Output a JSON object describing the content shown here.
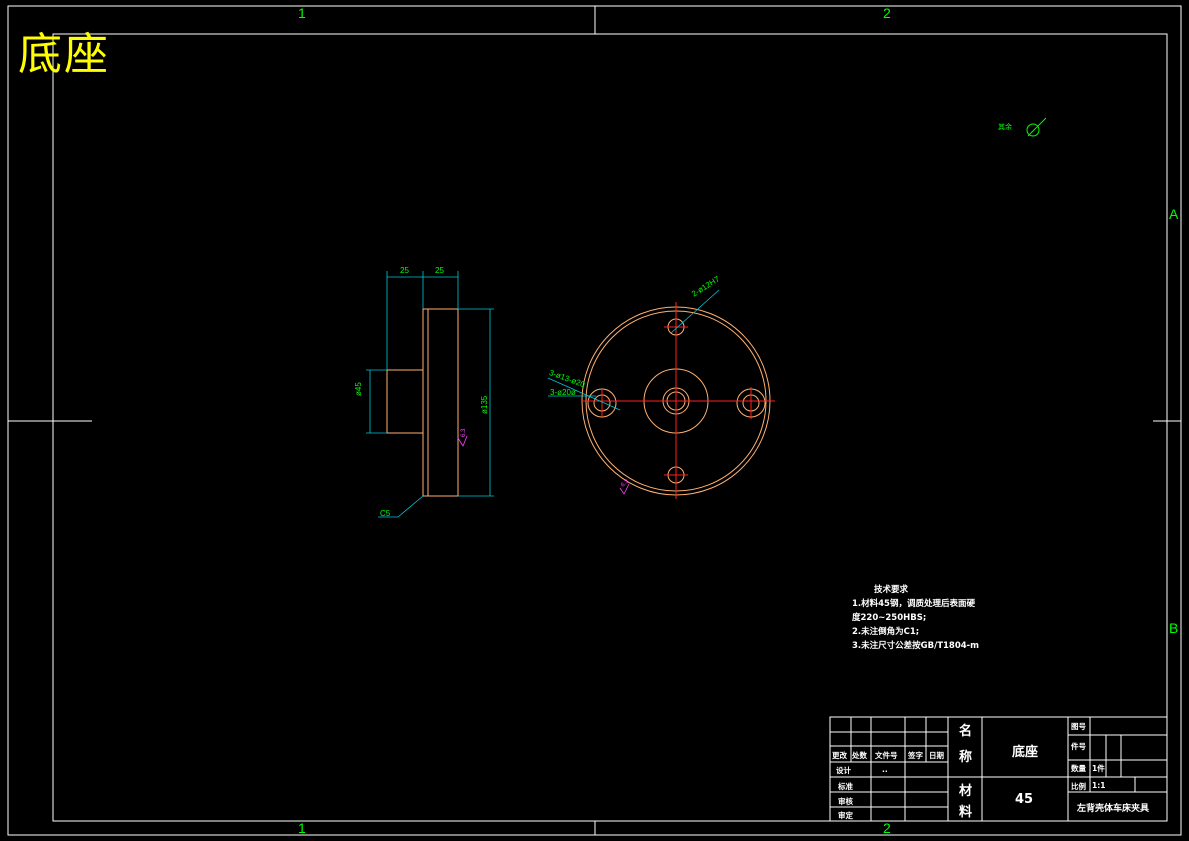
{
  "drawing": {
    "big_title": "底座",
    "zone_cols": [
      "1",
      "2"
    ],
    "zone_rows": [
      "A",
      "B"
    ]
  },
  "dimensions": {
    "side_width_a": "25",
    "side_width_b": "25",
    "hub_dia": "ø45",
    "flange_dia": "ø135",
    "chamfer": "C5",
    "top_holes": "2-ø12H7",
    "cbore_holes": "3-ø13-ø20",
    "cbore_small": "3-ø20ø",
    "roughness_side": "6.3",
    "roughness_front": "6.3",
    "roughness_other": "其余"
  },
  "notes": {
    "heading": "技术要求",
    "lines": [
      "1.材料45钢，调质处理后表面硬",
      "度220~250HBS;",
      "2.未注倒角为C1;",
      "3.未注尺寸公差按GB/T1804-m"
    ]
  },
  "title_block": {
    "name_label_1": "名",
    "name_label_2": "称",
    "part_name": "底座",
    "mat_label_1": "材",
    "mat_label_2": "料",
    "material": "45",
    "drawing_no_label": "图号",
    "piece_no_label": "件号",
    "qty_label": "数量",
    "qty_value": "1件",
    "scale_label": "比例",
    "scale_value": "1:1",
    "project": "左背壳体车床夹具",
    "hdr_mark": "更改",
    "hdr_count": "处数",
    "hdr_doc": "文件号",
    "hdr_sign": "签字",
    "hdr_date": "日期",
    "design_label": "设计",
    "design_value": "..",
    "standard_label": "标准",
    "review_label": "审核",
    "approve_label": "审定"
  }
}
